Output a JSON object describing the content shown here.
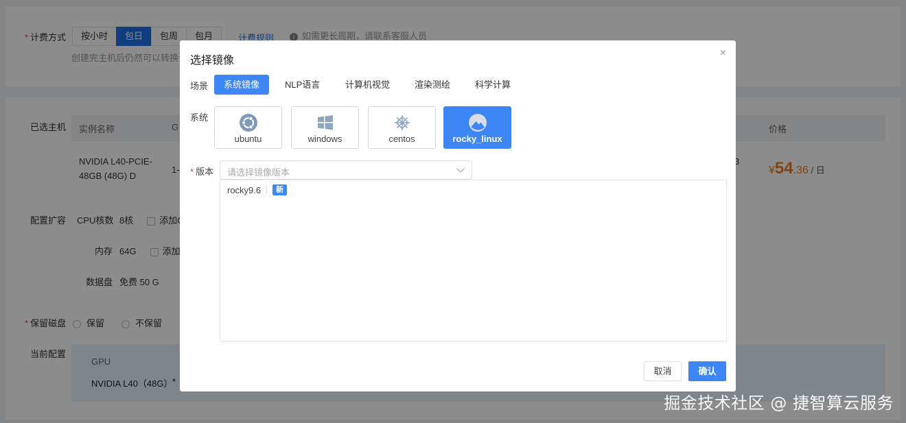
{
  "background": {
    "billing_label": "计费方式",
    "billing_options": [
      "按小时",
      "包日",
      "包周",
      "包月"
    ],
    "billing_rules_link": "计费规则",
    "billing_hint": "如需更长周期，请联系客服人员",
    "billing_note": "创建完主机后仍然可以转换计",
    "selected_host_label": "已选主机",
    "table_headers": [
      "实例名称",
      "G",
      "价格"
    ],
    "instance_name_line1": "NVIDIA L40-PCIE-",
    "instance_name_line2": "48GB (48G) D",
    "instance_col2": "1-",
    "instance_trailing": "3",
    "price_currency": "¥",
    "price_int": "54",
    "price_dec": ".36",
    "price_unit": "/ 日",
    "expand_label": "配置扩容",
    "cpu_label": "CPU核数",
    "cpu_value": "8核",
    "cpu_add": "添加C",
    "mem_label": "内存",
    "mem_value": "64G",
    "mem_add": "添加",
    "disk_label": "数据盘",
    "disk_value": "免费 50 G",
    "keep_disk_label": "保留磁盘",
    "keep_options": [
      "保留",
      "不保留"
    ],
    "current_config_label": "当前配置",
    "gpu_head": "GPU",
    "gpu_value": "NVIDIA L40（48G）",
    "gpu_mult": "*"
  },
  "modal": {
    "title": "选择镜像",
    "close": "×",
    "scene_label": "场景",
    "scene_tabs": [
      "系统镜像",
      "NLP语言",
      "计算机视觉",
      "渲染测绘",
      "科学计算"
    ],
    "scene_selected": "系统镜像",
    "system_label": "系统",
    "os_options": [
      {
        "name": "ubuntu",
        "icon": "ubuntu-icon"
      },
      {
        "name": "windows",
        "icon": "windows-icon"
      },
      {
        "name": "centos",
        "icon": "centos-icon"
      },
      {
        "name": "rocky_linux",
        "icon": "rocky-linux-icon"
      }
    ],
    "os_selected": "rocky_linux",
    "version_label": "版本",
    "version_placeholder": "请选择镜像版本",
    "versions": [
      {
        "label": "rocky9.6",
        "badge": "新"
      }
    ],
    "cancel_label": "取消",
    "confirm_label": "确认"
  },
  "colors": {
    "primary": "#3d86f5",
    "price": "#e67e22",
    "required": "#e53935"
  },
  "watermark": "掘金技术社区 @ 捷智算云服务"
}
